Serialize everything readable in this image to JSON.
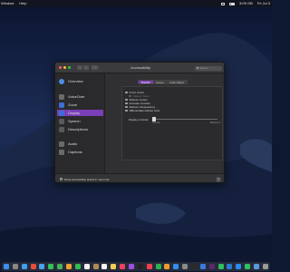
{
  "menubar": {
    "app_menu": "Window",
    "help_menu": "Help",
    "clock": "3:09 GB",
    "date": "Fri Jul 3"
  },
  "window": {
    "title": "Accessibility",
    "search_placeholder": "Search"
  },
  "sidebar": {
    "items": [
      {
        "label": "Overview",
        "icon": "overview-icon",
        "color": "#4a8fe0"
      },
      {
        "label": "VoiceOver",
        "icon": "voiceover-icon",
        "color": "#6b6b6b"
      },
      {
        "label": "Zoom",
        "icon": "zoom-icon",
        "color": "#3a6fd8"
      },
      {
        "label": "Display",
        "icon": "display-icon",
        "color": "#3a6fd8",
        "selected": true
      },
      {
        "label": "Speech",
        "icon": "speech-icon",
        "color": "#5a5a5a"
      },
      {
        "label": "Descriptions",
        "icon": "descriptions-icon",
        "color": "#5a5a5a"
      },
      {
        "label": "Audio",
        "icon": "audio-icon",
        "color": "#6a6a6a"
      },
      {
        "label": "Captions",
        "icon": "captions-icon",
        "color": "#6a6a6a"
      }
    ]
  },
  "display_pane": {
    "tabs": [
      {
        "label": "Display",
        "active": true
      },
      {
        "label": "Cursor",
        "active": false
      },
      {
        "label": "Color Filters",
        "active": false
      }
    ],
    "options": [
      {
        "label": "Invert colors",
        "enabled": true
      },
      {
        "label": "Classic Invert",
        "enabled": false
      },
      {
        "label": "Reduce motion",
        "enabled": true
      },
      {
        "label": "Increase contrast",
        "enabled": true
      },
      {
        "label": "Reduce transparency",
        "enabled": true
      },
      {
        "label": "Differentiate without color",
        "enabled": true
      }
    ],
    "contrast": {
      "label": "Display contrast:",
      "min_label": "Normal",
      "max_label": "Maximum",
      "value": 0.0
    }
  },
  "bottombar": {
    "show_status_label": "Show Accessibility status in menu bar",
    "help_label": "?"
  },
  "colors": {
    "accent": "#7b3fb8",
    "window_bg": "#303032"
  },
  "dock": {
    "icons": [
      {
        "name": "finder-icon",
        "color": "#3d8ef0"
      },
      {
        "name": "launchpad-icon",
        "color": "#888888"
      },
      {
        "name": "safari-icon",
        "color": "#3aa0f0"
      },
      {
        "name": "chrome-icon",
        "color": "#e74c3c"
      },
      {
        "name": "mail-icon",
        "color": "#4aa3f0"
      },
      {
        "name": "messages-icon",
        "color": "#32c25a"
      },
      {
        "name": "maps-icon",
        "color": "#46b05a"
      },
      {
        "name": "photos-icon",
        "color": "#f0a030"
      },
      {
        "name": "facetime-icon",
        "color": "#2fbf4f"
      },
      {
        "name": "calendar-icon",
        "color": "#f2f2f2"
      },
      {
        "name": "contacts-icon",
        "color": "#b08a5a"
      },
      {
        "name": "reminders-icon",
        "color": "#f4f4f4"
      },
      {
        "name": "notes-icon",
        "color": "#f0d050"
      },
      {
        "name": "music-icon",
        "color": "#f04060"
      },
      {
        "name": "podcasts-icon",
        "color": "#9a50e0"
      },
      {
        "name": "tv-icon",
        "color": "#222222"
      },
      {
        "name": "news-icon",
        "color": "#f04050"
      },
      {
        "name": "numbers-icon",
        "color": "#30b050"
      },
      {
        "name": "pages-icon",
        "color": "#f09a30"
      },
      {
        "name": "app-store-icon",
        "color": "#2f8ef0"
      },
      {
        "name": "system-preferences-icon",
        "color": "#8a8a8a"
      },
      {
        "name": "terminal-icon",
        "color": "#2a2a2a"
      },
      {
        "name": "xcode-icon",
        "color": "#3a7ae0"
      },
      {
        "name": "slack-icon",
        "color": "#5a2a6a"
      },
      {
        "name": "spotify-icon",
        "color": "#2fc060"
      },
      {
        "name": "vscode-icon",
        "color": "#2a7ad0"
      },
      {
        "name": "zoom-app-icon",
        "color": "#2a8af0"
      },
      {
        "name": "whatsapp-icon",
        "color": "#30c060"
      },
      {
        "name": "downloads-icon",
        "color": "#5a9ae0"
      },
      {
        "name": "trash-icon",
        "color": "#9a9a9a"
      }
    ]
  }
}
